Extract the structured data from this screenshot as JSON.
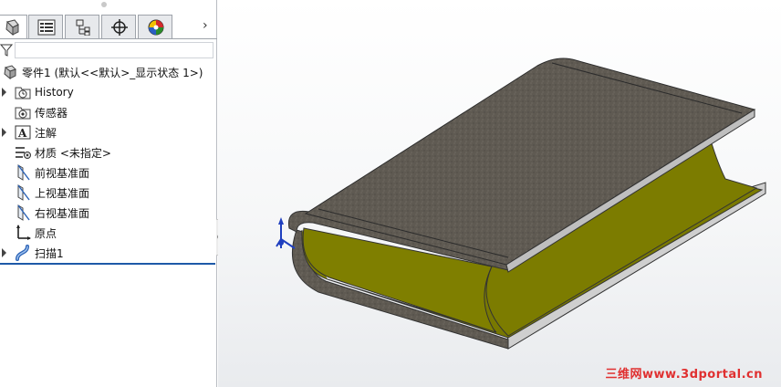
{
  "tabs": [
    {
      "name": "feature-manager"
    },
    {
      "name": "property-manager"
    },
    {
      "name": "configuration-manager"
    },
    {
      "name": "dimxpert-manager"
    },
    {
      "name": "display-manager"
    }
  ],
  "tree": {
    "root": "零件1 (默认<<默认>_显示状态 1>)",
    "items": [
      {
        "label": "History",
        "icon": "history-folder-icon",
        "expandable": true
      },
      {
        "label": "传感器",
        "icon": "sensor-folder-icon",
        "expandable": false
      },
      {
        "label": "注解",
        "icon": "annotation-icon",
        "expandable": true
      },
      {
        "label": "材质 <未指定>",
        "icon": "material-icon",
        "expandable": false
      },
      {
        "label": "前视基准面",
        "icon": "plane-icon",
        "expandable": false
      },
      {
        "label": "上视基准面",
        "icon": "plane-icon",
        "expandable": false
      },
      {
        "label": "右视基准面",
        "icon": "plane-icon",
        "expandable": false
      },
      {
        "label": "原点",
        "icon": "origin-icon",
        "expandable": false
      },
      {
        "label": "扫描1",
        "icon": "sweep-icon",
        "expandable": true
      }
    ]
  },
  "watermark": "三维网www.3dportal.cn",
  "colors": {
    "accent": "#1e5aa8",
    "model_outer": "#5c5850",
    "model_inner": "#7f7f00",
    "watermark": "#e03030"
  }
}
